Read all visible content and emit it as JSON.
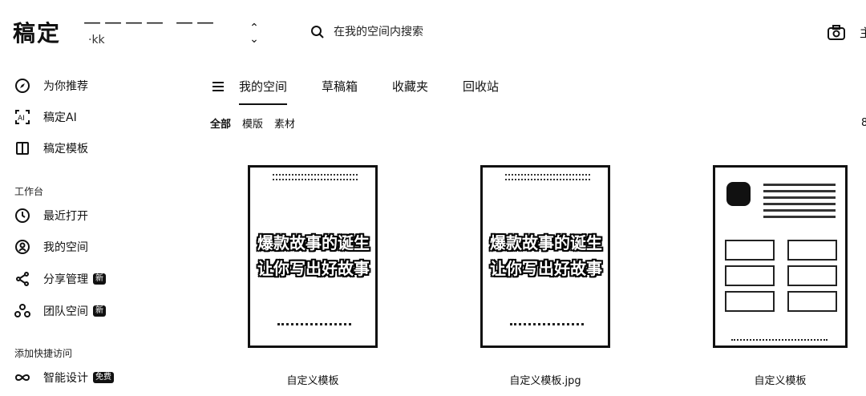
{
  "app": {
    "logo": "稿定",
    "team_name": "———— ——",
    "team_sub": "·kk",
    "search_placeholder": "在我的空间内搜索",
    "right_cut_text": "主"
  },
  "sidebar": {
    "items_top": [
      {
        "label": "为你推荐",
        "icon": "compass-icon"
      },
      {
        "label": "稿定AI",
        "icon": "ai-icon"
      },
      {
        "label": "稿定模板",
        "icon": "template-icon"
      }
    ],
    "section_workspace": "工作台",
    "items_workspace": [
      {
        "label": "最近打开",
        "icon": "clock-icon"
      },
      {
        "label": "我的空间",
        "icon": "user-icon"
      },
      {
        "label": "分享管理",
        "icon": "share-icon",
        "badge": "新"
      },
      {
        "label": "团队空间",
        "icon": "team-icon",
        "badge": "新"
      }
    ],
    "section_quick": "添加快捷访问",
    "items_quick": [
      {
        "label": "智能设计",
        "icon": "infinity-icon",
        "badge": "免费"
      }
    ]
  },
  "tabs": {
    "items": [
      {
        "label": "我的空间",
        "active": true
      },
      {
        "label": "草稿箱",
        "active": false
      },
      {
        "label": "收藏夹",
        "active": false
      },
      {
        "label": "回收站",
        "active": false
      }
    ],
    "filters": [
      "全部",
      "模版",
      "素材"
    ],
    "right_mark": "8"
  },
  "cards": [
    {
      "name": "自定义模板",
      "line1": "爆款故事的诞生",
      "line2": "让你写出好故事"
    },
    {
      "name": "自定义模板.jpg",
      "line1": "爆款故事的诞生",
      "line2": "让你写出好故事"
    },
    {
      "name": "自定义模板"
    }
  ]
}
